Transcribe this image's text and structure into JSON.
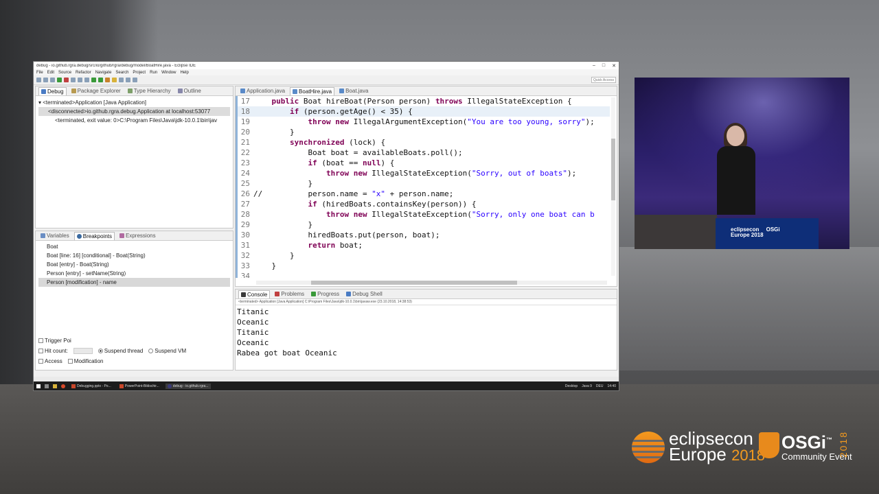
{
  "window": {
    "title": "debug - io.github.rgra.debug/src/io/github/rgra/debug/model/BoatHire.java - Eclipse IDE",
    "controls": [
      "–",
      "□",
      "✕"
    ]
  },
  "menu": [
    "File",
    "Edit",
    "Source",
    "Refactor",
    "Navigate",
    "Search",
    "Project",
    "Run",
    "Window",
    "Help"
  ],
  "toolbar": {
    "quick_access": "Quick Access"
  },
  "debug_view": {
    "tabs": [
      "Debug",
      "Package Explorer",
      "Type Hierarchy",
      "Outline"
    ],
    "tree": [
      "<terminated>Application [Java Application]",
      "<disconnected>io.github.rgra.debug.Application at localhost:53077",
      "<terminated, exit value: 0>C:\\Program Files\\Java\\jdk-10.0.1\\bin\\jav"
    ]
  },
  "breakpoints_view": {
    "tabs": [
      "Variables",
      "Breakpoints",
      "Expressions"
    ],
    "items": [
      "Boat",
      "Boat [line: 16] [conditional] - Boat(String)",
      "Boat [entry] - Boat(String)",
      "Person [entry] - setName(String)",
      "Person [modification] - name"
    ],
    "options": {
      "trigger_point": "Trigger Poi",
      "hit_count": "Hit count:",
      "suspend_thread": "Suspend thread",
      "suspend_vm": "Suspend VM",
      "access": "Access",
      "modification": "Modification"
    }
  },
  "editor": {
    "tabs": [
      "Application.java",
      "BoatHire.java",
      "Boat.java"
    ],
    "lines": [
      {
        "n": "17",
        "code": "    public Boat hireBoat(Person person) throws IllegalStateException {"
      },
      {
        "n": "18",
        "code": "        if (person.getAge() < 35) {"
      },
      {
        "n": "19",
        "code": "            throw new IllegalArgumentException(\"You are too young, sorry\");"
      },
      {
        "n": "20",
        "code": "        }"
      },
      {
        "n": "21",
        "code": "        synchronized (lock) {"
      },
      {
        "n": "22",
        "code": "            Boat boat = availableBoats.poll();"
      },
      {
        "n": "23",
        "code": "            if (boat == null) {"
      },
      {
        "n": "24",
        "code": "                throw new IllegalStateException(\"Sorry, out of boats\");"
      },
      {
        "n": "25",
        "code": "            }"
      },
      {
        "n": "26",
        "code": "//          person.name = \"x\" + person.name;"
      },
      {
        "n": "27",
        "code": "            if (hiredBoats.containsKey(person)) {"
      },
      {
        "n": "28",
        "code": "                throw new IllegalStateException(\"Sorry, only one boat can b"
      },
      {
        "n": "29",
        "code": "            }"
      },
      {
        "n": "30",
        "code": "            hiredBoats.put(person, boat);"
      },
      {
        "n": "31",
        "code": "            return boat;"
      },
      {
        "n": "32",
        "code": "        }"
      },
      {
        "n": "33",
        "code": "    }"
      },
      {
        "n": "34",
        "code": ""
      }
    ]
  },
  "console_view": {
    "tabs": [
      "Console",
      "Problems",
      "Progress",
      "Debug Shell"
    ],
    "launch_path": "<terminated> Application [Java Application] C:\\Program Files\\Java\\jdk-10.0.1\\bin\\javaw.exe (23.10.2018, 14:38:53)",
    "output": [
      "Titanic",
      "Oceanic",
      "Titanic",
      "Oceanic",
      "Rabea got boat Oceanic"
    ]
  },
  "taskbar": {
    "items": [
      "Debugging.pptx - Po...",
      "PowerPoint-Bildschir...",
      "debug - io.github.rgra..."
    ],
    "right": [
      "Desktop",
      "Java 9",
      "DEU",
      "14:40"
    ]
  },
  "branding": {
    "eclipsecon_line1": "eclipsecon",
    "eclipsecon_line2": "Europe",
    "eclipsecon_year": "2018",
    "osgi_name": "OSGi",
    "osgi_tm": "™",
    "osgi_sub": "Community Event",
    "osgi_year": "2018",
    "podium_text_1": "eclipsecon",
    "podium_text_2": "Europe 2018",
    "podium_text_3": "OSGi"
  },
  "colors": {
    "keyword": "#7f0055",
    "string": "#2a00ff",
    "brand_orange": "#f39a1f",
    "podium_blue": "#0e2e78"
  }
}
